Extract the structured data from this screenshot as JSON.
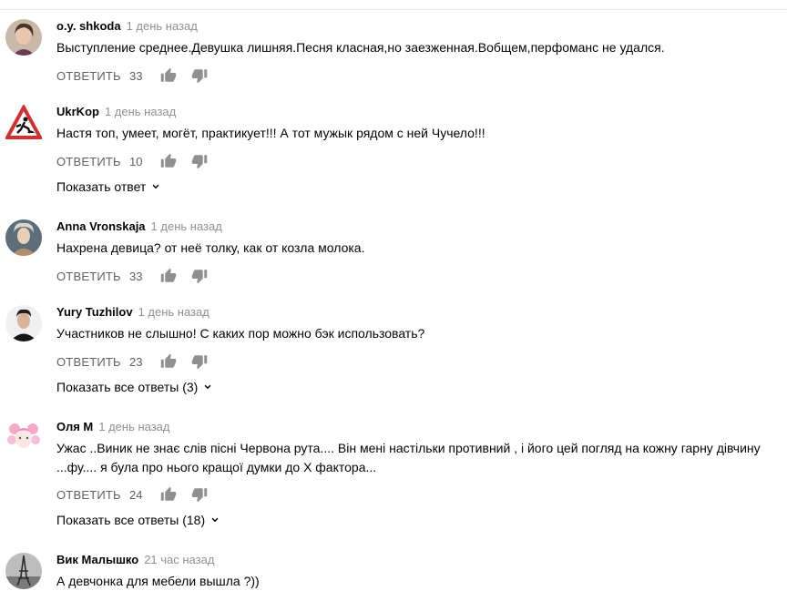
{
  "comments": [
    {
      "author": "o.y. shkoda",
      "time": "1 день назад",
      "text": "Выступление среднее.Девушка лишняя.Песня класная,но заезженная.Вобщем,перфоманс не удался.",
      "reply_label": "ОТВЕТИТЬ",
      "likes": "33",
      "avatar_icon": "woman-photo-avatar"
    },
    {
      "author": "UkrKop",
      "time": "1 день назад",
      "text": "Настя топ, умеет, могёт, практикует!!! А тот мужык рядом с ней Чучело!!!",
      "reply_label": "ОТВЕТИТЬ",
      "likes": "10",
      "avatar_icon": "road-work-sign-avatar",
      "replies_label": "Показать ответ"
    },
    {
      "author": "Anna Vronskaja",
      "time": "1 день назад",
      "text": "Нахрена девица? от неё толку, как от козла молока.",
      "reply_label": "ОТВЕТИТЬ",
      "likes": "33",
      "avatar_icon": "portrait-painting-avatar"
    },
    {
      "author": "Yury Tuzhilov",
      "time": "1 день назад",
      "text": "Участников не слышно! С каких пор можно бэк использовать?",
      "reply_label": "ОТВЕТИТЬ",
      "likes": "23",
      "avatar_icon": "man-photo-avatar",
      "replies_label": "Показать все ответы (3)"
    },
    {
      "author": "Оля М",
      "time": "1 день назад",
      "text_line1": "Ужас ..Виник не знає слів пісні Червона рута.... Він мені настільки противний , і його цей погляд на кожну гарну дівчину",
      "text_line2": "...фу.... я була про нього кращої думки до Х фактора...",
      "reply_label": "ОТВЕТИТЬ",
      "likes": "24",
      "avatar_icon": "pink-hair-drawing-avatar",
      "replies_label": "Показать все ответы (18)"
    },
    {
      "author": "Вик Малышко",
      "time": "21 час назад",
      "text": "А девчонка для мебели вышла ?))",
      "avatar_icon": "eiffel-tower-photo-avatar"
    }
  ],
  "colors": {
    "meta": "#909090",
    "action": "#606060",
    "text": "#030303"
  }
}
